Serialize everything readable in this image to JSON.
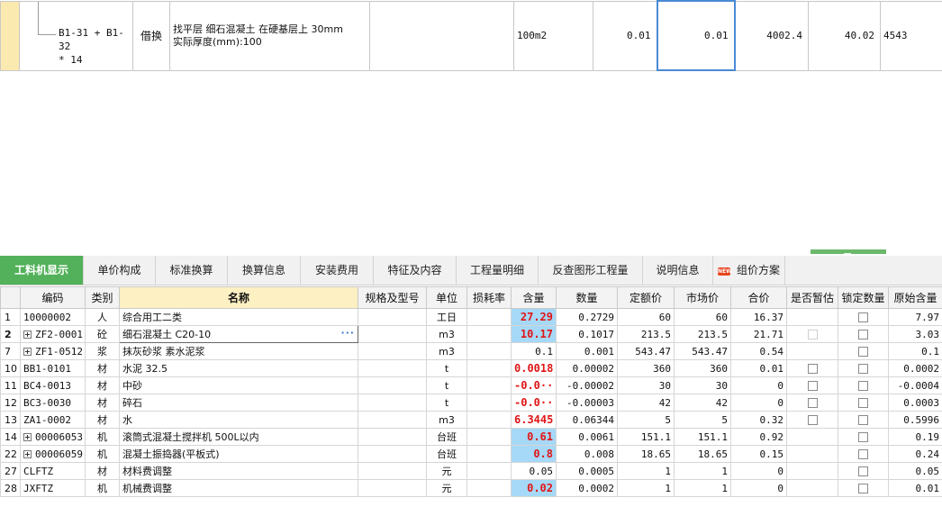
{
  "top_row": {
    "code_line1": "B1-31 + B1-32",
    "code_line2": "* 14",
    "type": "借换",
    "name_line1": "找平层 细石混凝土 在硬基层上 30mm",
    "name_line2": "实际厚度(mm):100",
    "unit": "100m2",
    "quantity_expr": "0.01",
    "quantity": "0.01",
    "unit_price": "4002.4",
    "total": "40.02",
    "extra": "4543"
  },
  "tabs": [
    {
      "label": "工料机显示",
      "active": true
    },
    {
      "label": "单价构成"
    },
    {
      "label": "标准换算"
    },
    {
      "label": "换算信息"
    },
    {
      "label": "安装费用"
    },
    {
      "label": "特征及内容"
    },
    {
      "label": "工程量明细"
    },
    {
      "label": "反查图形工程量"
    },
    {
      "label": "说明信息"
    },
    {
      "label": "组价方案",
      "badge": "NEW"
    }
  ],
  "columns": [
    "",
    "编码",
    "类别",
    "名称",
    "规格及型号",
    "单位",
    "损耗率",
    "含量",
    "数量",
    "定额价",
    "市场价",
    "合价",
    "是否暂估",
    "锁定数量",
    "原始含量"
  ],
  "rows": [
    {
      "idx": "1",
      "code": "10000002",
      "expand": false,
      "cat": "人",
      "name": "综合用工二类",
      "unit": "工日",
      "qty": "27.29",
      "qty_style": "red",
      "amount": "0.2729",
      "quota_price": "60",
      "market_price": "60",
      "total": "16.37",
      "temp_est": "none",
      "orig_qty": "7.97"
    },
    {
      "idx": "2",
      "code": "ZF2-0001",
      "expand": true,
      "cat": "砼",
      "name": "细石混凝土 C20-10",
      "unit": "m3",
      "qty": "10.17",
      "qty_style": "red",
      "amount": "0.1017",
      "quota_price": "213.5",
      "market_price": "213.5",
      "total": "21.71",
      "temp_est": "disabled",
      "orig_qty": "3.03",
      "current": true,
      "ellipsis": "···"
    },
    {
      "idx": "7",
      "code": "ZF1-0512",
      "expand": true,
      "cat": "浆",
      "name": "抹灰砂浆 素水泥浆",
      "unit": "m3",
      "qty": "0.1",
      "qty_style": "plain",
      "amount": "0.001",
      "quota_price": "543.47",
      "market_price": "543.47",
      "total": "0.54",
      "temp_est": "none",
      "orig_qty": "0.1"
    },
    {
      "idx": "10",
      "code": "BB1-0101",
      "expand": false,
      "cat": "材",
      "name": "水泥 32.5",
      "unit": "t",
      "qty": "0.0018",
      "qty_style": "redwhite",
      "amount": "0.00002",
      "quota_price": "360",
      "market_price": "360",
      "total": "0.01",
      "temp_est": "checkbox",
      "orig_qty": "0.0002"
    },
    {
      "idx": "11",
      "code": "BC4-0013",
      "expand": false,
      "cat": "材",
      "name": "中砂",
      "unit": "t",
      "qty": "-0.0···",
      "qty_style": "redwhite",
      "amount": "-0.00002",
      "quota_price": "30",
      "market_price": "30",
      "total": "0",
      "temp_est": "checkbox",
      "orig_qty": "-0.0004"
    },
    {
      "idx": "12",
      "code": "BC3-0030",
      "expand": false,
      "cat": "材",
      "name": "碎石",
      "unit": "t",
      "qty": "-0.0···",
      "qty_style": "redwhite",
      "amount": "-0.00003",
      "quota_price": "42",
      "market_price": "42",
      "total": "0",
      "temp_est": "checkbox",
      "orig_qty": "0.0003"
    },
    {
      "idx": "13",
      "code": "ZA1-0002",
      "expand": false,
      "cat": "材",
      "name": "水",
      "unit": "m3",
      "qty": "6.3445",
      "qty_style": "redwhite",
      "amount": "0.06344",
      "quota_price": "5",
      "market_price": "5",
      "total": "0.32",
      "temp_est": "checkbox",
      "orig_qty": "0.5996"
    },
    {
      "idx": "14",
      "code": "00006053",
      "expand": true,
      "cat": "机",
      "name": "滚筒式混凝土搅拌机 500L以内",
      "unit": "台班",
      "qty": "0.61",
      "qty_style": "red",
      "amount": "0.0061",
      "quota_price": "151.1",
      "market_price": "151.1",
      "total": "0.92",
      "temp_est": "none",
      "orig_qty": "0.19"
    },
    {
      "idx": "22",
      "code": "00006059",
      "expand": true,
      "cat": "机",
      "name": "混凝土振捣器(平板式)",
      "unit": "台班",
      "qty": "0.8",
      "qty_style": "red",
      "amount": "0.008",
      "quota_price": "18.65",
      "market_price": "18.65",
      "total": "0.15",
      "temp_est": "none",
      "orig_qty": "0.24"
    },
    {
      "idx": "27",
      "code": "CLFTZ",
      "expand": false,
      "cat": "材",
      "name": "材料费调整",
      "unit": "元",
      "qty": "0.05",
      "qty_style": "plain",
      "amount": "0.0005",
      "quota_price": "1",
      "market_price": "1",
      "total": "0",
      "temp_est": "none",
      "orig_qty": "0.05"
    },
    {
      "idx": "28",
      "code": "JXFTZ",
      "expand": false,
      "cat": "机",
      "name": "机械费调整",
      "unit": "元",
      "qty": "0.02",
      "qty_style": "red",
      "amount": "0.0002",
      "quota_price": "1",
      "market_price": "1",
      "total": "0",
      "temp_est": "none",
      "orig_qty": "0.01"
    }
  ],
  "colors": {
    "accent_green": "#52b15a",
    "header_yellow": "#fdf0c2",
    "qty_blue": "#a6d8f7",
    "qty_red": "#e01515"
  }
}
